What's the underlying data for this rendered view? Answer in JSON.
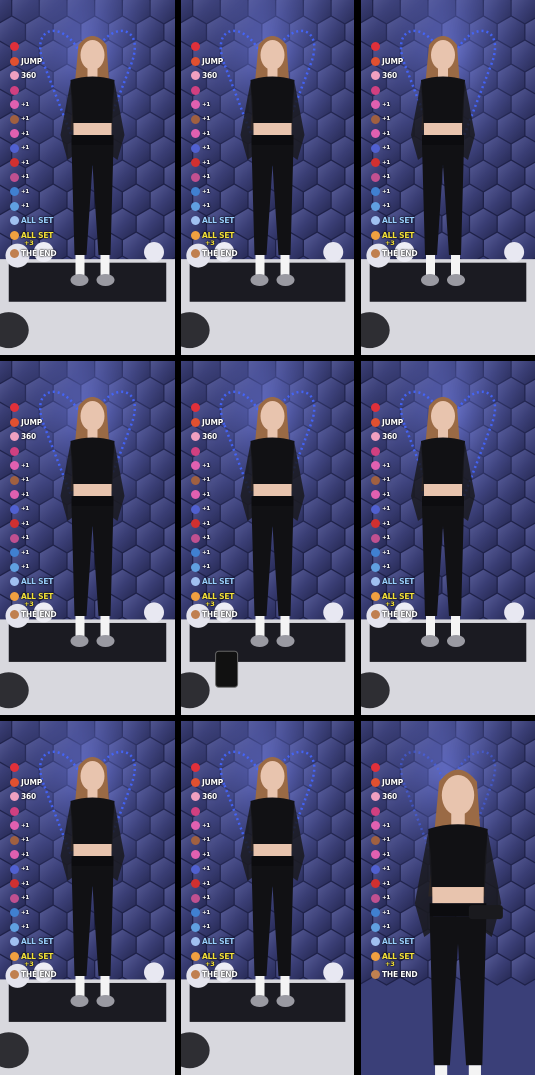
{
  "frames_count": 9,
  "overlay_items": [
    {
      "icon": "heart-icon",
      "color": "#e0303a",
      "label": ""
    },
    {
      "icon": "rocket-icon",
      "color": "#e05030",
      "label": "JUMP"
    },
    {
      "icon": "donut-icon",
      "color": "#f0a0c0",
      "label": "360"
    },
    {
      "icon": "flower-icon",
      "color": "#d04080",
      "label": ""
    },
    {
      "icon": "bow-icon",
      "color": "#e060b0",
      "label": ""
    },
    {
      "icon": "face-icon",
      "color": "#a06040",
      "label": ""
    },
    {
      "icon": "bow-icon",
      "color": "#e060b0",
      "label": ""
    },
    {
      "icon": "glasses-icon",
      "color": "#5060d0",
      "label": ""
    },
    {
      "icon": "shoe-icon",
      "color": "#d03030",
      "label": ""
    },
    {
      "icon": "dancer-icon",
      "color": "#c05090",
      "label": ""
    },
    {
      "icon": "bottle-icon",
      "color": "#4080d0",
      "label": ""
    },
    {
      "icon": "drop-icon",
      "color": "#60a0e0",
      "label": ""
    },
    {
      "icon": "ballet-icon",
      "color": "#a0c0f0",
      "label": "ALL SET"
    },
    {
      "icon": "flowers-icon",
      "color": "#f0a040",
      "label": "ALL SET"
    },
    {
      "icon": "bear-icon",
      "color": "#c08050",
      "label": "THE END"
    }
  ],
  "overlay_sub": {
    "jump_plus": "+1",
    "allset_plus": "+3"
  },
  "colors": {
    "wall": "#3a3f78",
    "glow": "#4466ff",
    "floor": "#d8d8de",
    "outfit": "#111114",
    "skin": "#e8c4ae",
    "hair": "#9a6a45"
  }
}
